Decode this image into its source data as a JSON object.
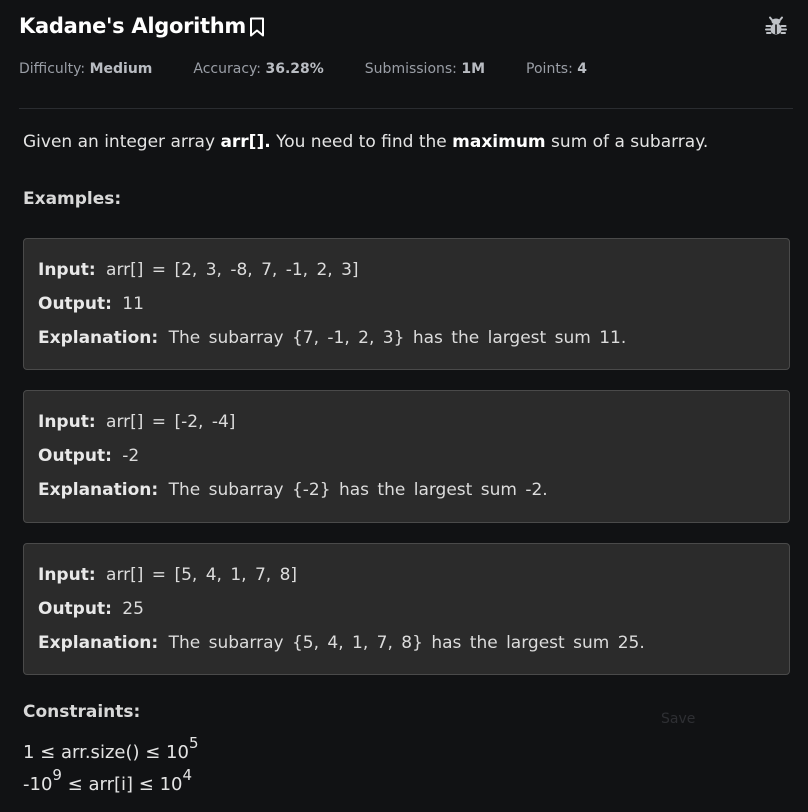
{
  "problem": {
    "title": "Kadane's Algorithm",
    "meta": {
      "difficulty_label": "Difficulty:",
      "difficulty_value": "Medium",
      "accuracy_label": "Accuracy:",
      "accuracy_value": "36.28%",
      "submissions_label": "Submissions:",
      "submissions_value": "1M",
      "points_label": "Points:",
      "points_value": "4"
    },
    "intro": {
      "part1": "Given an integer array ",
      "bold1": "arr[].",
      "part2": " You need to find the ",
      "bold2": "maximum",
      "part3": " sum of a subarray."
    },
    "examples_title": "Examples:",
    "labels": {
      "input": "Input:",
      "output": "Output:",
      "explanation": "Explanation:"
    },
    "examples": [
      {
        "input": "arr[] = [2, 3, -8, 7, -1, 2, 3]",
        "output": "11",
        "explanation": "The subarray {7, -1, 2, 3} has the largest sum 11."
      },
      {
        "input": "arr[] = [-2, -4]",
        "output": "-2",
        "explanation": "The subarray {-2} has the largest sum -2."
      },
      {
        "input": "arr[] = [5, 4, 1, 7, 8]",
        "output": "25",
        "explanation": "The subarray {5, 4, 1, 7, 8} has the largest sum 25."
      }
    ],
    "constraints_title": "Constraints:",
    "constraints": [
      {
        "pre": "1 ≤ arr.size() ≤ 10",
        "pre_sup": "",
        "mid": "",
        "sup": "5"
      },
      {
        "pre": "-10",
        "pre_sup": "9",
        "mid": " ≤ arr[i] ≤ 10",
        "sup": "4"
      }
    ],
    "save_label": "Save"
  },
  "colors": {
    "background": "#111214",
    "example_box": "#2b2b2b",
    "meta_text": "#9a9ea6"
  },
  "icons": {
    "bookmark": "bookmark-icon",
    "bug": "bug-icon"
  }
}
